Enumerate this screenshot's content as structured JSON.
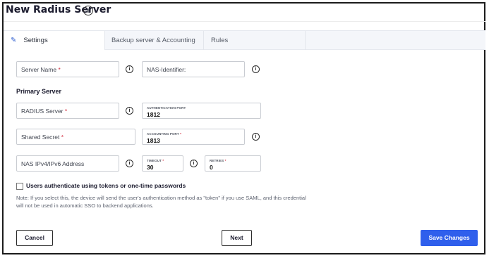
{
  "dialog": {
    "title": "New Radius Server",
    "title_info_icon": "info-icon"
  },
  "tabs": [
    {
      "label": "Settings",
      "icon": "pencil-icon",
      "active": true
    },
    {
      "label": "Backup server & Accounting",
      "active": false
    },
    {
      "label": "Rules",
      "active": false
    }
  ],
  "fields": {
    "server_name": {
      "placeholder": "Server Name",
      "required": "*"
    },
    "nas_identifier": {
      "placeholder": "NAS-Identifier:"
    },
    "primary_section": "Primary Server",
    "radius_server": {
      "placeholder": "RADIUS Server",
      "required": "*"
    },
    "auth_port": {
      "label": "AUTHENTICATION PORT",
      "value": "1812"
    },
    "shared_secret": {
      "placeholder": "Shared Secret",
      "required": "*"
    },
    "acct_port": {
      "label": "ACCOUNTING PORT",
      "required": "*",
      "value": "1813"
    },
    "nas_ip": {
      "placeholder": "NAS IPv4/IPv6 Address"
    },
    "timeout": {
      "label": "TIMEOUT",
      "required": "*",
      "value": "30"
    },
    "retries": {
      "label": "RETRIES",
      "required": "*",
      "value": "0"
    }
  },
  "token_option": {
    "label": "Users authenticate using tokens or one-time passwords",
    "checked": false,
    "note": "Note: If you select this, the device will send the user's authentication method as \"token\" if you use SAML, and this credential will not be used in automatic SSO to backend applications."
  },
  "buttons": {
    "cancel": "Cancel",
    "next": "Next",
    "save": "Save Changes"
  },
  "colors": {
    "accent": "#2f5fec",
    "required": "#d2283a",
    "tabs_bg": "#f4f6fa"
  }
}
